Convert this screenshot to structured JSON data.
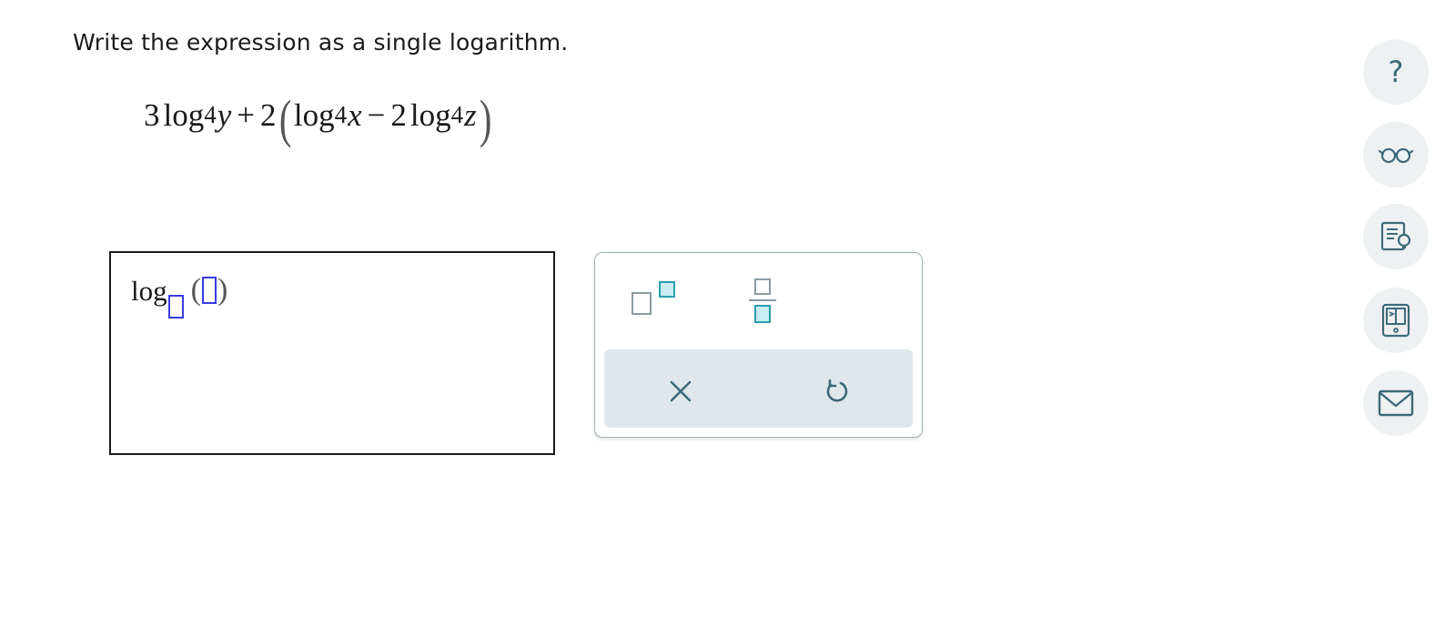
{
  "question": {
    "prompt": "Write the expression as a single logarithm.",
    "expression": {
      "coef1": "3",
      "log": "log",
      "base": "4",
      "var_y": "y",
      "plus": "+",
      "coef2": "2",
      "lparen": "(",
      "var_x": "x",
      "minus": "−",
      "coef3": "2",
      "var_z": "z",
      "rparen": ")"
    }
  },
  "answer": {
    "log_text": "log",
    "lparen": "(",
    "rparen": ")"
  },
  "palette": {
    "icons": {
      "exponent": "exponent-template-icon",
      "fraction": "fraction-template-icon",
      "clear": "close-x-icon",
      "undo": "undo-icon"
    },
    "colors": {
      "icon_gray": "#8a9aa1",
      "icon_teal": "#2a9db0",
      "icon_teal_fill": "#c9edf2",
      "toolbar_bg": "#dfe7ea",
      "action_icon": "#3d6a7a"
    }
  },
  "sidebar": {
    "help_label": "?",
    "icons": [
      "question-mark-icon",
      "glasses-icon",
      "textbook-icon",
      "calculator-icon",
      "mail-icon"
    ]
  },
  "colors": {
    "placeholder_blue": "#3a3ae0",
    "side_button_bg": "#eef1f2",
    "side_icon": "#3d6a7a"
  }
}
